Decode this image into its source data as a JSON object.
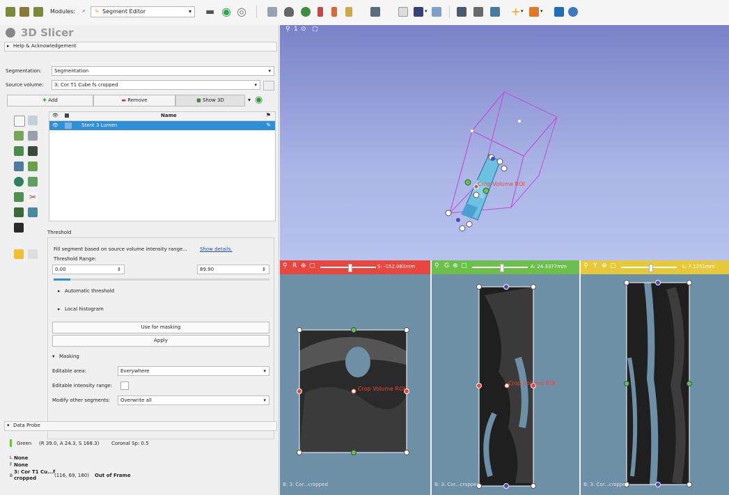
{
  "toolbar": {
    "modules_label": "Modules:",
    "module_selected": "Segment Editor"
  },
  "app": {
    "logo_text": "3D Slicer",
    "help_section": "Help & Acknowledgement"
  },
  "segmentation": {
    "segmentation_label": "Segmentation:",
    "segmentation_value": "Segmentation",
    "source_label": "Source volume:",
    "source_value": "3: Cor T1 Cube fs cropped",
    "add_label": "Add",
    "remove_label": "Remove",
    "show3d_label": "Show 3D",
    "table_header_name": "Name",
    "segment_name": "Stent 3 Lumen"
  },
  "threshold": {
    "section_label": "Threshold",
    "description": "Fill segment based on source volume intensity range...",
    "show_details": "Show details.",
    "range_label": "Threshold Range:",
    "min_value": "0.00",
    "max_value": "89.90",
    "auto_threshold": "Automatic threshold",
    "local_histogram": "Local histogram",
    "use_for_masking": "Use for masking",
    "apply": "Apply"
  },
  "masking": {
    "section_label": "Masking",
    "editable_area_label": "Editable area:",
    "editable_area_value": "Everywhere",
    "editable_intensity_label": "Editable intensity range:",
    "modify_other_label": "Modify other segments:",
    "modify_other_value": "Overwrite all"
  },
  "data_probe": {
    "section_label": "Data Probe",
    "view_name": "Green",
    "ras_text": "(R 39.0, A 24.3, S 168.3)",
    "sp_text": "Coronal Sp: 0.5",
    "l_label": "L",
    "l_value": "None",
    "f_label": "F",
    "f_value": "None",
    "b_label": "B",
    "b_value_line1": "3: Cor T1 Cu...f",
    "b_value_line2": "cropped",
    "b_coords": "(116, 69, 180)",
    "b_status": "Out of Frame"
  },
  "view3d": {
    "roi_label": "Crop Volume ROI"
  },
  "slice_views": [
    {
      "name": "red",
      "offset": "S: -152.083mm",
      "roi_label": "Crop Volume ROI",
      "footer": "B: 3: Cor...cropped",
      "color": "#e8473f"
    },
    {
      "name": "green",
      "offset": "A: 24.3377mm",
      "roi_label": "Crop Volume ROI",
      "footer": "B: 3: Cor...cropped",
      "color": "#6cbf4a"
    },
    {
      "name": "yellow",
      "offset": "L: 7.1251mm",
      "roi_label": "",
      "footer": "B: 3: Cor...cropped",
      "color": "#e6c93a"
    }
  ],
  "colors": {
    "selection": "#2e8fd6",
    "view3d_top": "#7a82c8",
    "slice_bg": "#6e90a6"
  }
}
